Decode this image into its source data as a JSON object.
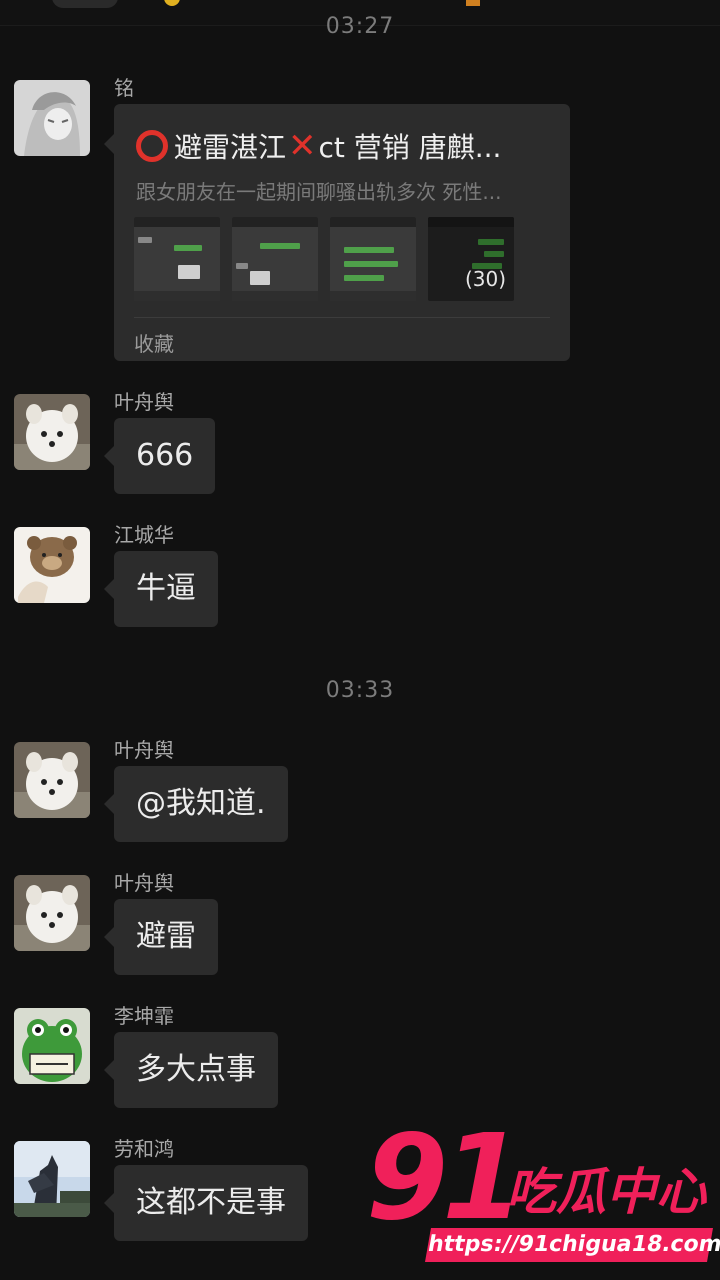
{
  "timestamps": [
    "03:27",
    "03:33"
  ],
  "messages": [
    {
      "sender": "铭",
      "card": {
        "title_part1": "避雷湛江",
        "title_part2": "ct 营销 唐麒...",
        "description": "跟女朋友在一起期间聊骚出轨多次 死性...",
        "image_count": "(30)",
        "footer": "收藏"
      }
    },
    {
      "sender": "叶舟舆",
      "text": "666"
    },
    {
      "sender": "江城华",
      "text": "牛逼"
    },
    {
      "sender": "叶舟舆",
      "text": "@我知道."
    },
    {
      "sender": "叶舟舆",
      "text": "避雷"
    },
    {
      "sender": "李坤霏",
      "text": "多大点事"
    },
    {
      "sender": "劳和鸿",
      "text": "这都不是事"
    }
  ],
  "watermark": {
    "number": "91",
    "name": "吃瓜中心",
    "url": "https://91chigua18.com"
  },
  "colors": {
    "background": "#111111",
    "bubble": "#2c2c2c",
    "accent_red": "#e0322b",
    "watermark_pink": "#f0205a"
  }
}
